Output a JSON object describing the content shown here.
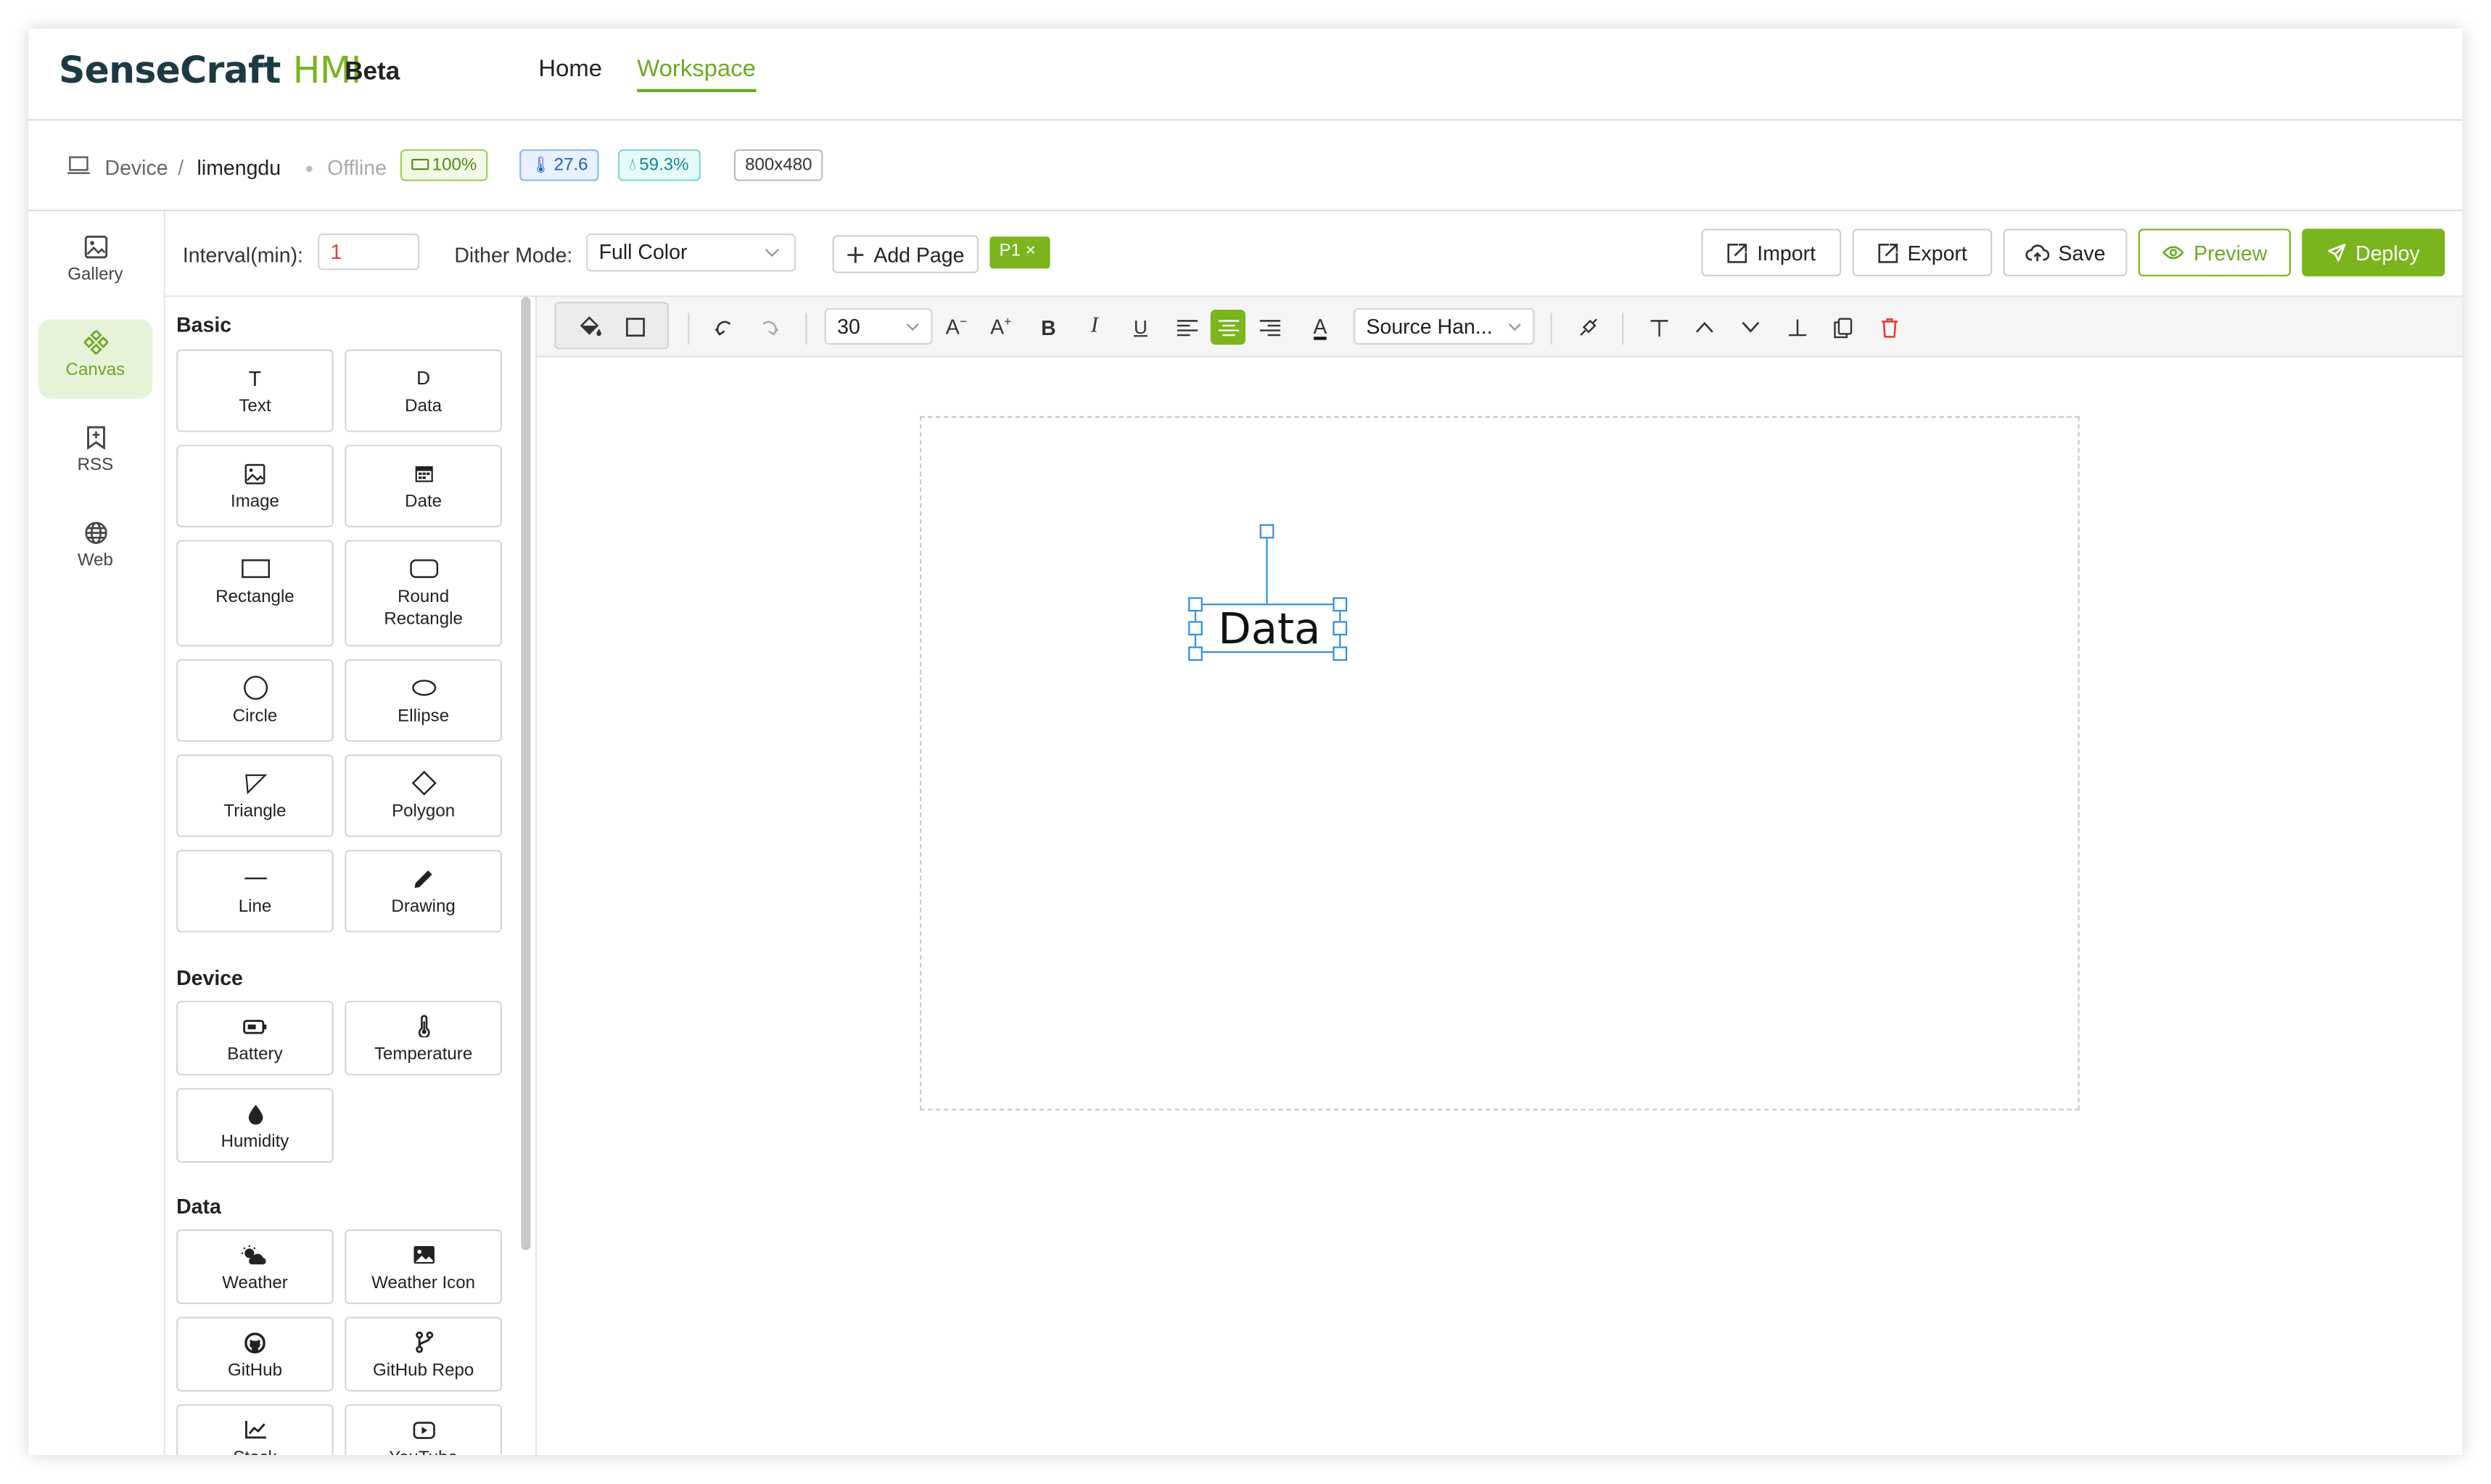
{
  "app": {
    "brand": "SenseCraft",
    "brand_accent": "HMI",
    "badge": "Beta",
    "accent_color": "#7ab51d"
  },
  "nav": {
    "home": "Home",
    "workspace": "Workspace"
  },
  "device_bar": {
    "breadcrumb_root": "Device",
    "separator": "/",
    "device_name": "limengdu",
    "status": "Offline",
    "battery": "100%",
    "temperature": "27.6",
    "humidity": "59.3%",
    "resolution": "800x480"
  },
  "rail": {
    "items": [
      {
        "label": "Gallery",
        "icon": "image-icon"
      },
      {
        "label": "Canvas",
        "icon": "canvas-icon"
      },
      {
        "label": "RSS",
        "icon": "bookmark-plus-icon"
      },
      {
        "label": "Web",
        "icon": "globe-icon"
      }
    ]
  },
  "toolbar": {
    "interval_label": "Interval(min):",
    "interval_value": "1",
    "dither_label": "Dither Mode:",
    "dither_value": "Full Color",
    "add_page": "Add Page",
    "page_tag": "P1",
    "import": "Import",
    "export": "Export",
    "save": "Save",
    "preview": "Preview",
    "deploy": "Deploy"
  },
  "panel": {
    "basic_title": "Basic",
    "basic": [
      {
        "label": "Text",
        "icon": "text-icon",
        "glyph": "T"
      },
      {
        "label": "Data",
        "icon": "data-icon",
        "glyph": "D"
      },
      {
        "label": "Image",
        "icon": "image-icon"
      },
      {
        "label": "Date",
        "icon": "calendar-icon"
      },
      {
        "label": "Rectangle",
        "icon": "rectangle-icon"
      },
      {
        "label": "Round Rectangle",
        "icon": "round-rectangle-icon"
      },
      {
        "label": "Circle",
        "icon": "circle-icon"
      },
      {
        "label": "Ellipse",
        "icon": "ellipse-icon"
      },
      {
        "label": "Triangle",
        "icon": "triangle-icon"
      },
      {
        "label": "Polygon",
        "icon": "polygon-icon"
      },
      {
        "label": "Line",
        "icon": "line-icon"
      },
      {
        "label": "Drawing",
        "icon": "pencil-icon"
      }
    ],
    "device_title": "Device",
    "device": [
      {
        "label": "Battery",
        "icon": "battery-icon"
      },
      {
        "label": "Temperature",
        "icon": "thermometer-icon"
      },
      {
        "label": "Humidity",
        "icon": "droplet-icon"
      }
    ],
    "data_title": "Data",
    "data": [
      {
        "label": "Weather",
        "icon": "weather-icon"
      },
      {
        "label": "Weather Icon",
        "icon": "weather-image-icon"
      },
      {
        "label": "GitHub",
        "icon": "github-icon"
      },
      {
        "label": "GitHub Repo",
        "icon": "git-branch-icon"
      },
      {
        "label": "Stock",
        "icon": "stock-chart-icon"
      },
      {
        "label": "YouTube",
        "icon": "youtube-icon"
      }
    ]
  },
  "canvas_tools": {
    "font_size": "30",
    "font_family": "Source Han..."
  },
  "canvas": {
    "element_text": "Data",
    "selection_color": "#2a8ee0"
  }
}
